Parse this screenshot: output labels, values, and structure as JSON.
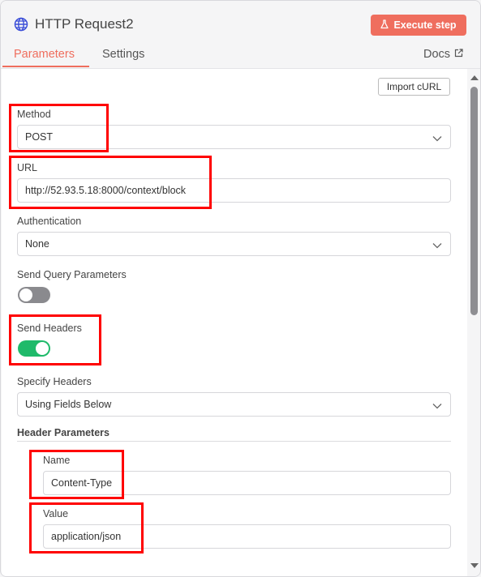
{
  "header": {
    "title": "HTTP Request2",
    "execute_label": "Execute step",
    "tabs": [
      {
        "label": "Parameters",
        "active": true
      },
      {
        "label": "Settings",
        "active": false
      }
    ],
    "docs_label": "Docs"
  },
  "main": {
    "import_curl_label": "Import cURL",
    "method": {
      "label": "Method",
      "value": "POST"
    },
    "url": {
      "label": "URL",
      "value": "http://52.93.5.18:8000/context/block"
    },
    "authentication": {
      "label": "Authentication",
      "value": "None"
    },
    "send_query": {
      "label": "Send Query Parameters",
      "enabled": false
    },
    "send_headers": {
      "label": "Send Headers",
      "enabled": true
    },
    "specify_headers": {
      "label": "Specify Headers",
      "value": "Using Fields Below"
    },
    "header_parameters": {
      "title": "Header Parameters",
      "name": {
        "label": "Name",
        "value": "Content-Type"
      },
      "value": {
        "label": "Value",
        "value": "application/json"
      }
    }
  },
  "colors": {
    "accent": "#ef6e5e",
    "toggle_on": "#1fba6a",
    "toggle_off": "#8a8a8e",
    "highlight": "#ff0000"
  },
  "icons": [
    "globe-icon",
    "flask-icon",
    "external-link-icon",
    "chevron-down-icon"
  ]
}
